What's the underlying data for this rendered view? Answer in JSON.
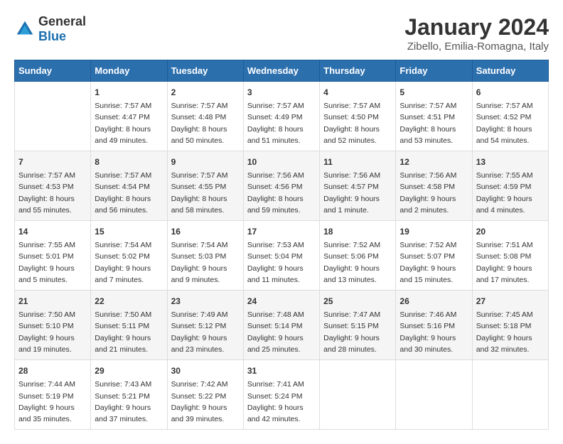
{
  "header": {
    "logo": {
      "general": "General",
      "blue": "Blue"
    },
    "title": "January 2024",
    "subtitle": "Zibello, Emilia-Romagna, Italy"
  },
  "calendar": {
    "weekdays": [
      "Sunday",
      "Monday",
      "Tuesday",
      "Wednesday",
      "Thursday",
      "Friday",
      "Saturday"
    ],
    "weeks": [
      [
        {
          "day": "",
          "info": ""
        },
        {
          "day": "1",
          "info": "Sunrise: 7:57 AM\nSunset: 4:47 PM\nDaylight: 8 hours\nand 49 minutes."
        },
        {
          "day": "2",
          "info": "Sunrise: 7:57 AM\nSunset: 4:48 PM\nDaylight: 8 hours\nand 50 minutes."
        },
        {
          "day": "3",
          "info": "Sunrise: 7:57 AM\nSunset: 4:49 PM\nDaylight: 8 hours\nand 51 minutes."
        },
        {
          "day": "4",
          "info": "Sunrise: 7:57 AM\nSunset: 4:50 PM\nDaylight: 8 hours\nand 52 minutes."
        },
        {
          "day": "5",
          "info": "Sunrise: 7:57 AM\nSunset: 4:51 PM\nDaylight: 8 hours\nand 53 minutes."
        },
        {
          "day": "6",
          "info": "Sunrise: 7:57 AM\nSunset: 4:52 PM\nDaylight: 8 hours\nand 54 minutes."
        }
      ],
      [
        {
          "day": "7",
          "info": "Sunrise: 7:57 AM\nSunset: 4:53 PM\nDaylight: 8 hours\nand 55 minutes."
        },
        {
          "day": "8",
          "info": "Sunrise: 7:57 AM\nSunset: 4:54 PM\nDaylight: 8 hours\nand 56 minutes."
        },
        {
          "day": "9",
          "info": "Sunrise: 7:57 AM\nSunset: 4:55 PM\nDaylight: 8 hours\nand 58 minutes."
        },
        {
          "day": "10",
          "info": "Sunrise: 7:56 AM\nSunset: 4:56 PM\nDaylight: 8 hours\nand 59 minutes."
        },
        {
          "day": "11",
          "info": "Sunrise: 7:56 AM\nSunset: 4:57 PM\nDaylight: 9 hours\nand 1 minute."
        },
        {
          "day": "12",
          "info": "Sunrise: 7:56 AM\nSunset: 4:58 PM\nDaylight: 9 hours\nand 2 minutes."
        },
        {
          "day": "13",
          "info": "Sunrise: 7:55 AM\nSunset: 4:59 PM\nDaylight: 9 hours\nand 4 minutes."
        }
      ],
      [
        {
          "day": "14",
          "info": "Sunrise: 7:55 AM\nSunset: 5:01 PM\nDaylight: 9 hours\nand 5 minutes."
        },
        {
          "day": "15",
          "info": "Sunrise: 7:54 AM\nSunset: 5:02 PM\nDaylight: 9 hours\nand 7 minutes."
        },
        {
          "day": "16",
          "info": "Sunrise: 7:54 AM\nSunset: 5:03 PM\nDaylight: 9 hours\nand 9 minutes."
        },
        {
          "day": "17",
          "info": "Sunrise: 7:53 AM\nSunset: 5:04 PM\nDaylight: 9 hours\nand 11 minutes."
        },
        {
          "day": "18",
          "info": "Sunrise: 7:52 AM\nSunset: 5:06 PM\nDaylight: 9 hours\nand 13 minutes."
        },
        {
          "day": "19",
          "info": "Sunrise: 7:52 AM\nSunset: 5:07 PM\nDaylight: 9 hours\nand 15 minutes."
        },
        {
          "day": "20",
          "info": "Sunrise: 7:51 AM\nSunset: 5:08 PM\nDaylight: 9 hours\nand 17 minutes."
        }
      ],
      [
        {
          "day": "21",
          "info": "Sunrise: 7:50 AM\nSunset: 5:10 PM\nDaylight: 9 hours\nand 19 minutes."
        },
        {
          "day": "22",
          "info": "Sunrise: 7:50 AM\nSunset: 5:11 PM\nDaylight: 9 hours\nand 21 minutes."
        },
        {
          "day": "23",
          "info": "Sunrise: 7:49 AM\nSunset: 5:12 PM\nDaylight: 9 hours\nand 23 minutes."
        },
        {
          "day": "24",
          "info": "Sunrise: 7:48 AM\nSunset: 5:14 PM\nDaylight: 9 hours\nand 25 minutes."
        },
        {
          "day": "25",
          "info": "Sunrise: 7:47 AM\nSunset: 5:15 PM\nDaylight: 9 hours\nand 28 minutes."
        },
        {
          "day": "26",
          "info": "Sunrise: 7:46 AM\nSunset: 5:16 PM\nDaylight: 9 hours\nand 30 minutes."
        },
        {
          "day": "27",
          "info": "Sunrise: 7:45 AM\nSunset: 5:18 PM\nDaylight: 9 hours\nand 32 minutes."
        }
      ],
      [
        {
          "day": "28",
          "info": "Sunrise: 7:44 AM\nSunset: 5:19 PM\nDaylight: 9 hours\nand 35 minutes."
        },
        {
          "day": "29",
          "info": "Sunrise: 7:43 AM\nSunset: 5:21 PM\nDaylight: 9 hours\nand 37 minutes."
        },
        {
          "day": "30",
          "info": "Sunrise: 7:42 AM\nSunset: 5:22 PM\nDaylight: 9 hours\nand 39 minutes."
        },
        {
          "day": "31",
          "info": "Sunrise: 7:41 AM\nSunset: 5:24 PM\nDaylight: 9 hours\nand 42 minutes."
        },
        {
          "day": "",
          "info": ""
        },
        {
          "day": "",
          "info": ""
        },
        {
          "day": "",
          "info": ""
        }
      ]
    ]
  }
}
